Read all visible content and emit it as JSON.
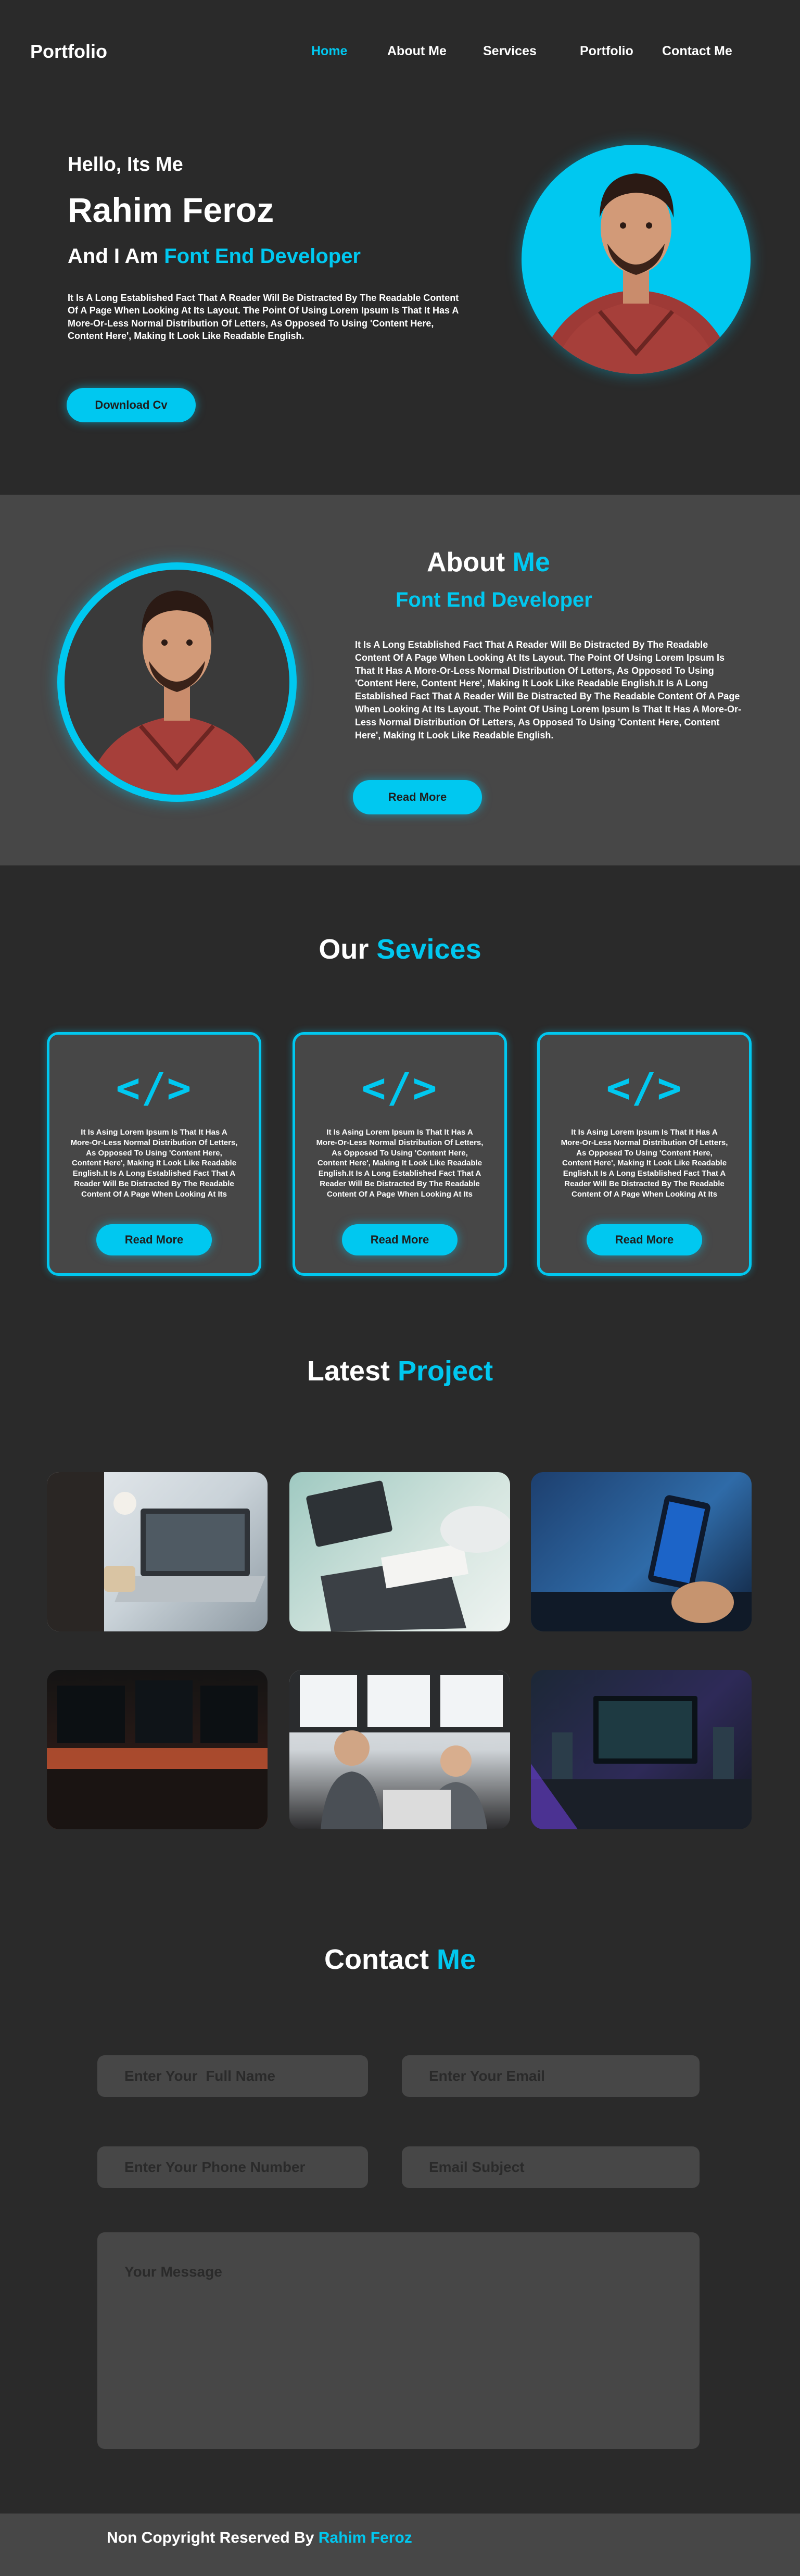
{
  "nav": {
    "logo": "Portfolio",
    "links": [
      "Home",
      "About Me",
      "Services",
      "Portfolio",
      "Contact Me"
    ],
    "active": "Home"
  },
  "hero": {
    "greeting": "Hello, Its Me",
    "name": "Rahim Feroz",
    "role_prefix": "And I  Am",
    "role_accent": "Font End Developer",
    "description": "It Is A Long Established Fact That A Reader Will Be Distracted By The Readable Content Of A Page When Looking At Its Layout. The Point Of Using Lorem Ipsum Is That It Has A More-Or-Less Normal Distribution Of Letters, As Opposed To Using 'Content Here, Content Here', Making It Look Like Readable English.",
    "button": "Download Cv"
  },
  "about": {
    "title_plain": "About",
    "title_accent": "Me",
    "subtitle": "Font End Developer",
    "description": "It Is A Long Established Fact That A Reader Will Be Distracted By The Readable Content Of A Page When Looking At Its Layout. The Point Of Using Lorem Ipsum Is That It Has A More-Or-Less Normal Distribution Of Letters, As Opposed To Using 'Content Here, Content Here', Making It Look Like Readable English.It Is A Long Established Fact That A Reader Will Be Distracted By The Readable Content Of A Page When Looking At Its Layout. The Point Of Using Lorem Ipsum Is That It Has A More-Or-Less Normal Distribution Of Letters, As Opposed To Using 'Content Here, Content Here', Making It Look Like Readable English.",
    "button": "Read More"
  },
  "services": {
    "title_plain": "Our",
    "title_accent": "Sevices",
    "cards": [
      {
        "icon": "code-icon",
        "glyph": "</>",
        "text": "It Is Asing Lorem Ipsum Is That It Has A More-Or-Less Normal Distribution Of Letters, As Opposed To Using 'Content Here, Content Here', Making It Look Like Readable English.It Is A Long Established Fact That A Reader Will Be Distracted By The Readable Content Of A Page When Looking At Its Layout.",
        "button": "Read More"
      },
      {
        "icon": "code-icon",
        "glyph": "</>",
        "text": "It Is Asing Lorem Ipsum Is That It Has A More-Or-Less Normal Distribution Of Letters, As Opposed To Using 'Content Here, Content Here', Making It Look Like Readable English.It Is A Long Established Fact That A Reader Will Be Distracted By The Readable Content Of A Page When Looking At Its Layout.",
        "button": "Read More"
      },
      {
        "icon": "code-icon",
        "glyph": "</>",
        "text": "It Is Asing Lorem Ipsum Is That It Has A More-Or-Less Normal Distribution Of Letters, As Opposed To Using 'Content Here, Content Here', Making It Look Like Readable English.It Is A Long Established Fact That A Reader Will Be Distracted By The Readable Content Of A Page When Looking At Its Layout.",
        "button": "Read More"
      }
    ]
  },
  "projects": {
    "title_plain": "Latest",
    "title_accent": "Project"
  },
  "contact": {
    "title_plain": "Contact",
    "title_accent": "Me",
    "full_name_placeholder": "Enter Your  Full Name",
    "email_placeholder": "Enter Your Email",
    "phone_placeholder": "Enter Your Phone Number",
    "subject_placeholder": "Email Subject",
    "message_placeholder": "Your Message"
  },
  "footer": {
    "text_plain": "Non Copyright Reserved By",
    "text_accent": "Rahim Feroz"
  },
  "colors": {
    "accent": "#00c8f0",
    "background": "#2a2a2a",
    "panel": "#474747"
  }
}
